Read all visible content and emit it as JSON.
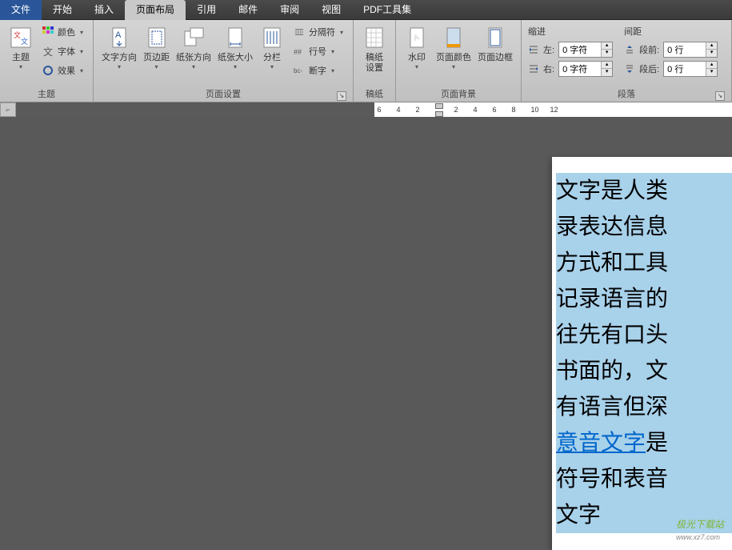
{
  "menubar": {
    "file": "文件",
    "tabs": [
      "开始",
      "插入",
      "页面布局",
      "引用",
      "邮件",
      "审阅",
      "视图",
      "PDF工具集"
    ],
    "active_index": 2
  },
  "ribbon": {
    "theme": {
      "label": "主题",
      "main": "主题",
      "color": "颜色",
      "font": "字体",
      "effect": "效果"
    },
    "page_setup": {
      "label": "页面设置",
      "text_dir": "文字方向",
      "margin": "页边距",
      "orient": "纸张方向",
      "size": "纸张大小",
      "columns": "分栏",
      "breaks": "分隔符",
      "line_num": "行号",
      "hyphen": "断字"
    },
    "manuscript": {
      "label": "稿纸",
      "btn": "稿纸\n设置"
    },
    "page_bg": {
      "label": "页面背景",
      "watermark": "水印",
      "color": "页面颜色",
      "border": "页面边框"
    },
    "paragraph": {
      "label": "段落",
      "indent_heading": "缩进",
      "spacing_heading": "间距",
      "left_label": "左:",
      "right_label": "右:",
      "before_label": "段前:",
      "after_label": "段后:",
      "left_val": "0 字符",
      "right_val": "0 字符",
      "before_val": "0 行",
      "after_val": "0 行"
    }
  },
  "ruler": {
    "numbers": [
      "6",
      "4",
      "2",
      "2",
      "4",
      "6",
      "8",
      "10",
      "12"
    ]
  },
  "document": {
    "lines": [
      "文字是人类",
      "录表达信息",
      "方式和工具",
      "记录语言的",
      "往先有口头",
      "书面的，文",
      "有语言但深"
    ],
    "link_text": "意音文字",
    "link_after": "是",
    "lines2": [
      "符号和表音",
      "文字"
    ],
    "watermark_name": "极光下载站",
    "watermark_url": "www.xz7.com"
  }
}
